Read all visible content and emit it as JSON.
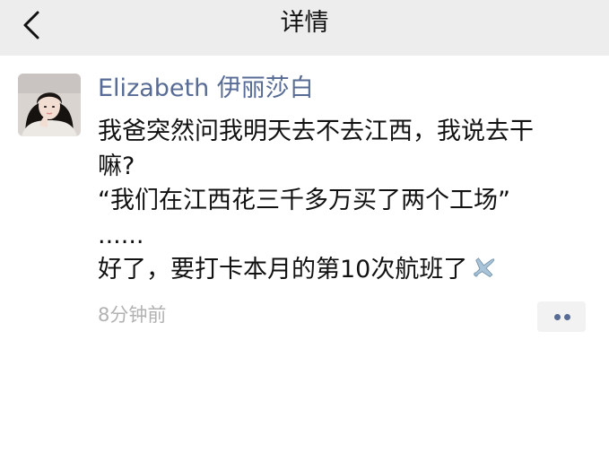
{
  "header": {
    "title": "详情",
    "back_icon": "chevron-left-icon"
  },
  "post": {
    "username": "Elizabeth 伊丽莎白",
    "lines": [
      "我爸突然问我明天去不去江西，我说去干",
      "嘛?",
      "“我们在江西花三千多万买了两个工场”",
      "......",
      "好了，要打卡本月的第10次航班了"
    ],
    "emoji": "airplane-icon",
    "timestamp": "8分钟前",
    "more_icon": "more-dots-icon"
  },
  "colors": {
    "header_bg": "#ededed",
    "username": "#576b95",
    "body_text": "#111111",
    "timestamp": "#b2b2b2",
    "more_btn_bg": "#f2f2f2"
  }
}
